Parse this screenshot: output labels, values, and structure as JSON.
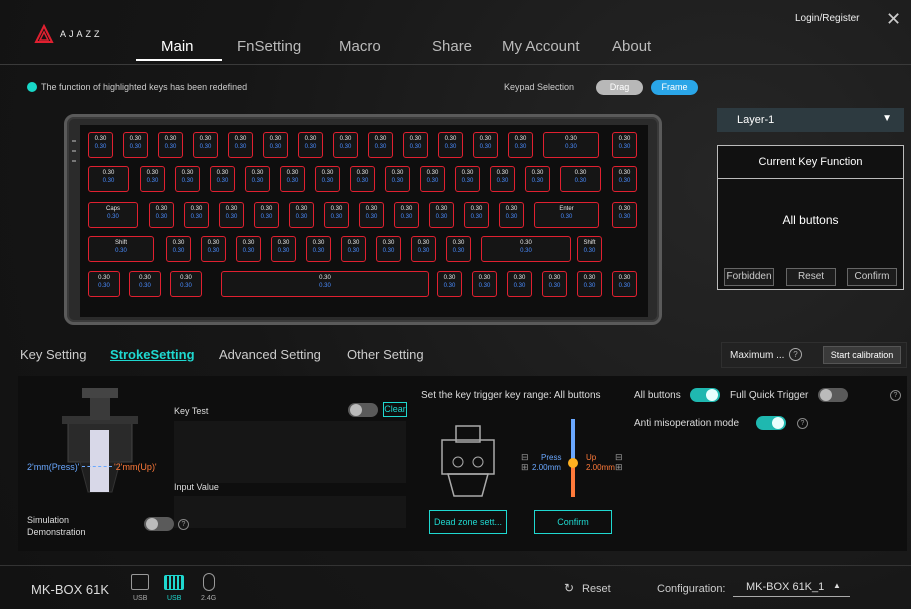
{
  "app": {
    "brand": "AJAZZ",
    "login": "Login/Register"
  },
  "nav": {
    "tabs": [
      "Main",
      "FnSetting",
      "Macro",
      "Share",
      "My Account",
      "About"
    ]
  },
  "info": {
    "text": "The function of highlighted keys has been redefined"
  },
  "keypad": {
    "label": "Keypad Selection",
    "drag": "Drag",
    "frame": "Frame"
  },
  "keyboard": {
    "value": "0.30",
    "rows": [
      [
        "0.30",
        "0.30",
        "0.30",
        "0.30",
        "0.30",
        "0.30",
        "0.30",
        "0.30",
        "0.30",
        "0.30",
        "0.30",
        "0.30",
        "0.30",
        "0.30",
        "0.30"
      ],
      [
        "0.30",
        "0.30",
        "0.30",
        "0.30",
        "0.30",
        "0.30",
        "0.30",
        "0.30",
        "0.30",
        "0.30",
        "0.30",
        "0.30",
        "0.30",
        "0.30",
        "0.30"
      ],
      [
        "Caps",
        "0.30",
        "0.30",
        "0.30",
        "0.30",
        "0.30",
        "0.30",
        "0.30",
        "0.30",
        "0.30",
        "0.30",
        "0.30",
        "Enter",
        "0.30"
      ],
      [
        "Shift",
        "0.30",
        "0.30",
        "0.30",
        "0.30",
        "0.30",
        "0.30",
        "0.30",
        "0.30",
        "0.30",
        "0.30",
        "Shift",
        "0.30"
      ],
      [
        "0.30",
        "0.30",
        "0.30",
        "0.30",
        "0.30",
        "0.30",
        "0.30",
        "0.30",
        "0.30",
        "0.30"
      ]
    ]
  },
  "layer": {
    "selected": "Layer-1"
  },
  "ckf": {
    "title": "Current Key Function",
    "value": "All buttons",
    "forbidden": "Forbidden",
    "reset": "Reset",
    "confirm": "Confirm"
  },
  "subtabs": [
    "Key Setting",
    "StrokeSetting",
    "Advanced Setting",
    "Other Setting"
  ],
  "maximum": {
    "label": "Maximum ...",
    "calibration": "Start calibration"
  },
  "stroke": {
    "press_label": "2'mm(Press)'",
    "up_label": "'2'mm(Up)'",
    "key_test": "Key Test",
    "clear": "Clear",
    "input_value": "Input Value",
    "simulation": "Simulation Demonstration",
    "range_label": "Set the key trigger key range: All buttons",
    "press": "Press",
    "press_val": "2.00mm",
    "up": "Up",
    "up_val": "2.00mm",
    "dead_zone": "Dead zone sett...",
    "confirm": "Confirm",
    "all_buttons": "All buttons",
    "full_quick": "Full Quick Trigger",
    "anti": "Anti misoperation mode"
  },
  "footer": {
    "device": "MK-BOX 61K",
    "usb1": "USB",
    "usb2": "USB",
    "wireless": "2.4G",
    "reset": "Reset",
    "config_label": "Configuration:",
    "config_value": "MK-BOX 61K_1"
  },
  "colors": {
    "accent": "#1fd8d0",
    "key_border": "#e02030",
    "key_value": "#4a8cff",
    "frame_pill": "#2aa6e8"
  }
}
